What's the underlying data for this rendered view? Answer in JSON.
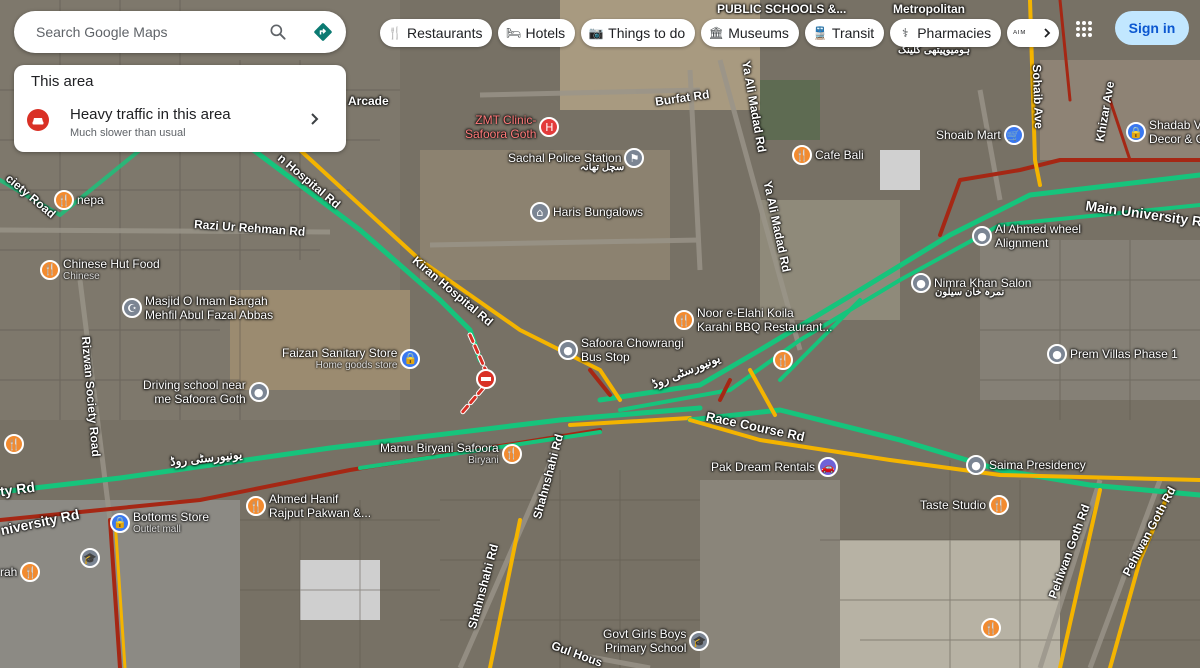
{
  "search": {
    "placeholder": "Search Google Maps"
  },
  "chips": [
    {
      "label": "Restaurants",
      "icon": "restaurant-icon",
      "glyph": "🍴"
    },
    {
      "label": "Hotels",
      "icon": "hotel-icon",
      "glyph": "🛏"
    },
    {
      "label": "Things to do",
      "icon": "camera-icon",
      "glyph": "📷"
    },
    {
      "label": "Museums",
      "icon": "museum-icon",
      "glyph": "🏛"
    },
    {
      "label": "Transit",
      "icon": "transit-icon",
      "glyph": "🚆"
    },
    {
      "label": "Pharmacies",
      "icon": "pharmacy-icon",
      "glyph": "⚕"
    }
  ],
  "chips_more_label": "ATMs",
  "signin": "Sign in",
  "card": {
    "title": "This area",
    "heading": "Heavy traffic in this area",
    "subtitle": "Much slower than usual"
  },
  "colors": {
    "traffic_green": "#16c47c",
    "traffic_yellow": "#f4b400",
    "traffic_red": "#a52714",
    "signin_bg": "#c2e7ff",
    "signin_text": "#0b57d0"
  },
  "map_labels": {
    "roads": [
      "Burfat Rd",
      "Ya Ali Madad Rd",
      "Ya Ali Madad Rd",
      "Kiran Hospital Rd",
      "n Hospital Rd",
      "Razi Ur Rehman Rd",
      "Rizwan Society Road",
      "Race Course Rd",
      "Main University Rd",
      "ty Rd",
      "niversity Rd",
      "Shahnshahi Rd",
      "Shahnshahi Rd",
      "Pehlwan Goth Rd",
      "Pehlwan Goth Rd",
      "Sohaib Ave",
      "Khizar Ave",
      "ciety Road",
      "Gul Hous",
      "PUBLIC SCHOOLS &...",
      "Metropolitan"
    ],
    "urdu": [
      "یونیورسٹی روڈ",
      "یونیورسٹی روڈ"
    ],
    "arcade": "Arcade",
    "urdu_sachal": "سچل تھانہ",
    "urdu_nimra": "نمرہ خان سیلون",
    "urdu_sohaib": "ہومیوپیتھی کلینک"
  },
  "pois": [
    {
      "name": "ZMT Clinic-",
      "name2": "Safoora Goth",
      "type": "red",
      "glyph": "H"
    },
    {
      "name": "Sachal Police Station",
      "type": "gray",
      "glyph": "⚑"
    },
    {
      "name": "Haris Bungalows",
      "type": "gray",
      "glyph": "⌂"
    },
    {
      "name": "Cafe Bali",
      "type": "food",
      "glyph": "🍴"
    },
    {
      "name": "Shoaib Mart",
      "type": "blue",
      "glyph": "🛒"
    },
    {
      "name": "Shadab V",
      "name2": "Decor & C",
      "type": "blue",
      "glyph": "🔒"
    },
    {
      "name": "Al Ahmed wheel",
      "name2": "Alignment",
      "type": "gray",
      "glyph": "●"
    },
    {
      "name": "Nimra Khan Salon",
      "type": "gray",
      "glyph": "●"
    },
    {
      "name": "Prem Villas Phase 1",
      "type": "gray",
      "glyph": "●"
    },
    {
      "name": "Noor e-Elahi Koila",
      "name2": "Karahi BBQ Restaurant...",
      "type": "food",
      "glyph": "🍴"
    },
    {
      "name": "Safoora Chowrangi",
      "name2": "Bus Stop",
      "type": "gray",
      "glyph": "●"
    },
    {
      "name": "Faizan Sanitary Store",
      "sub": "Home goods store",
      "type": "blue",
      "glyph": "🔒"
    },
    {
      "name": "Driving school near",
      "name2": "me Safoora Goth",
      "type": "gray",
      "glyph": "●"
    },
    {
      "name": "Masjid O Imam Bargah",
      "name2": "Mehfil Abul Fazal Abbas",
      "type": "gray",
      "glyph": "🕌"
    },
    {
      "name": "Chinese Hut Food",
      "sub": "Chinese",
      "type": "food",
      "glyph": "🍴"
    },
    {
      "name": "nepa",
      "type": "food",
      "glyph": "🍴"
    },
    {
      "name": "Mamu Biryani Safoora",
      "sub": "Biryani",
      "type": "food",
      "glyph": "🍴"
    },
    {
      "name": "Ahmed Hanif",
      "name2": "Rajput Pakwan &...",
      "type": "food",
      "glyph": "🍴"
    },
    {
      "name": "Bottoms Store",
      "sub": "Outlet mall",
      "type": "blue",
      "glyph": "🔒"
    },
    {
      "name": "Pak Dream Rentals",
      "type": "violet",
      "glyph": "🚗"
    },
    {
      "name": "Saima Presidency",
      "type": "gray",
      "glyph": "●"
    },
    {
      "name": "Taste Studio",
      "type": "food",
      "glyph": "🍴"
    },
    {
      "name": "Govt Girls Boys",
      "name2": "Primary School",
      "type": "gray",
      "glyph": "🎓"
    },
    {
      "name": "rah",
      "type": "food",
      "glyph": "🍴"
    }
  ]
}
